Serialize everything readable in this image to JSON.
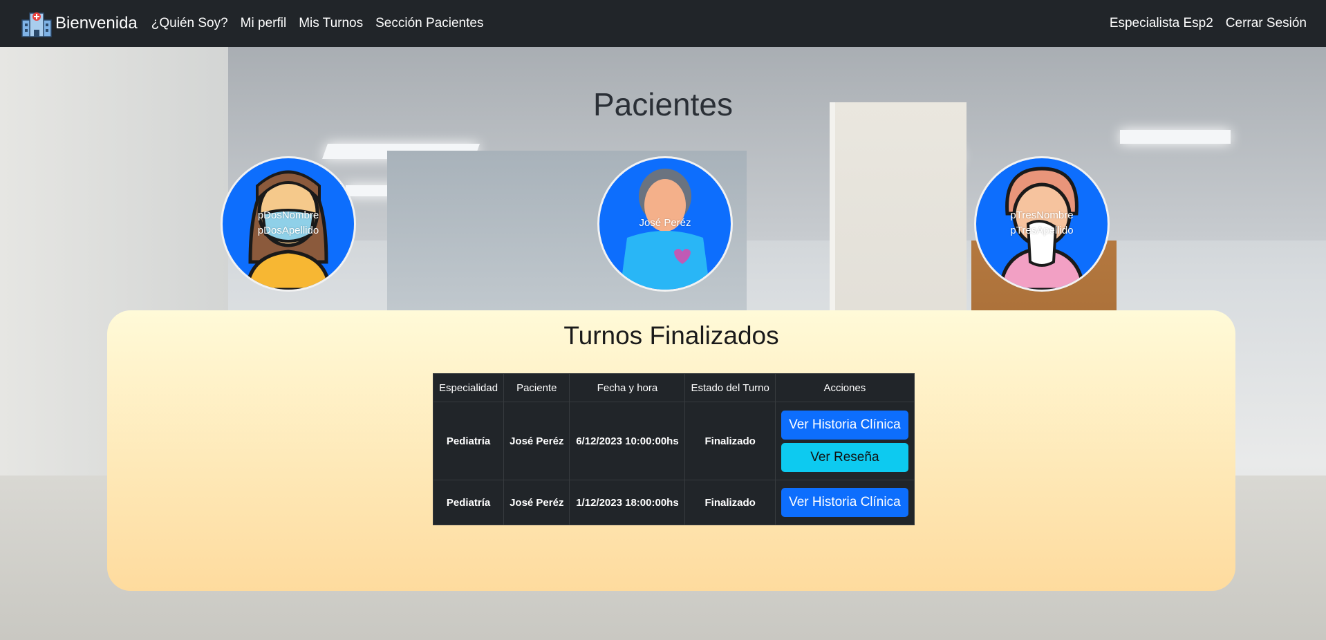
{
  "navbar": {
    "brand": "Bienvenida",
    "links": [
      "¿Quién Soy?",
      "Mi perfil",
      "Mis Turnos",
      "Sección Pacientes"
    ],
    "user": "Especialista Esp2",
    "logout": "Cerrar Sesión"
  },
  "page_title": "Pacientes",
  "patients": [
    {
      "first": "pDosNombre",
      "last": "pDosApellido"
    },
    {
      "full": "José Peréz"
    },
    {
      "first": "pTresNombre",
      "last": "pTresApellido"
    }
  ],
  "appointments": {
    "title": "Turnos Finalizados",
    "headers": [
      "Especialidad",
      "Paciente",
      "Fecha y hora",
      "Estado del Turno",
      "Acciones"
    ],
    "rows": [
      {
        "especialidad": "Pediatría",
        "paciente": "José Peréz",
        "fecha": "6/12/2023 10:00:00hs",
        "estado": "Finalizado",
        "btn_historia": "Ver Historia Clínica",
        "btn_resena": "Ver Reseña"
      },
      {
        "especialidad": "Pediatría",
        "paciente": "José Peréz",
        "fecha": "1/12/2023 18:00:00hs",
        "estado": "Finalizado",
        "btn_historia": "Ver Historia Clínica"
      }
    ]
  },
  "colors": {
    "navbar": "#212529",
    "primary": "#0d6efd",
    "info": "#0dcaf0",
    "panel_top": "#fffad8",
    "panel_bottom": "#fedb9e"
  }
}
